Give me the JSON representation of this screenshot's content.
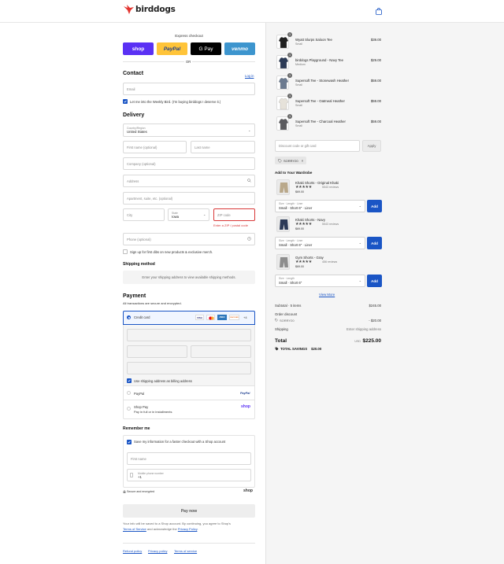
{
  "header": {
    "brand": "birddogs",
    "cart_icon": "shopping-bag-icon"
  },
  "express": {
    "title": "Express checkout",
    "shop": "shop",
    "paypal": "PayPal",
    "gpay": "G Pay",
    "venmo": "venmo",
    "or": "OR"
  },
  "contact": {
    "title": "Contact",
    "login": "Log in",
    "email_placeholder": "Email",
    "newsletter": "Let me into the Weekly Bird. (I'm buying birddogs I deserve it.)"
  },
  "delivery": {
    "title": "Delivery",
    "country_label": "Country/Region",
    "country_value": "United States",
    "first_name": "First name (optional)",
    "last_name": "Last name",
    "company": "Company (optional)",
    "address": "Address",
    "apartment": "Apartment, suite, etc. (optional)",
    "city": "City",
    "state_label": "State",
    "state_value": "Iowa",
    "zip": "ZIP code",
    "zip_error": "Enter a ZIP / postal code",
    "phone": "Phone (optional)",
    "signup": "Sign up for first dibs on new products & exclusive merch."
  },
  "shipping": {
    "title": "Shipping method",
    "note": "Enter your shipping address to view available shipping methods."
  },
  "payment": {
    "title": "Payment",
    "subtitle": "All transactions are secure and encrypted.",
    "credit_card": "Credit card",
    "card_brands": [
      "VISA",
      "MC",
      "AMEX",
      "DISCOVER",
      "+4"
    ],
    "billing_same": "Use shipping address as billing address",
    "paypal": "PayPal",
    "paypal_logo": "PayPal",
    "shop_pay": "Shop Pay",
    "shop_pay_sub": "Pay in full or in installments",
    "shop_logo": "shop"
  },
  "remember": {
    "title": "Remember me",
    "save": "Save my information for a faster checkout with a Shop account",
    "first_name": "First name",
    "mobile_label": "Mobile phone number",
    "mobile_value": "+1",
    "secure": "Secure and encrypted",
    "shop_logo": "shop"
  },
  "pay_now": "Pay now",
  "legal": {
    "text1": "Your info will be saved to a Shop account. By continuing, you agree to Shop's",
    "terms": "Terms of Service",
    "and": " and acknowledge the ",
    "privacy": "Privacy Policy",
    "end": "."
  },
  "footer": {
    "refund": "Refund policy",
    "privacy": "Privacy policy",
    "terms": "Terms of service"
  },
  "cart": {
    "items": [
      {
        "name": "Wyatt Slurps Saloon Tee",
        "variant": "Small",
        "price": "$39.00",
        "qty": "1",
        "color": "#1f1f1f"
      },
      {
        "name": "birddogs Playground - Navy Tee",
        "variant": "Medium",
        "price": "$29.00",
        "qty": "1",
        "color": "#2b3a55"
      },
      {
        "name": "Supersoft Tee - Stonewash Heather",
        "variant": "Small",
        "price": "$59.00",
        "qty": "1",
        "color": "#6b7a8f"
      },
      {
        "name": "Supersoft Tee - Oatmeal Heather",
        "variant": "Small",
        "price": "$59.00",
        "qty": "1",
        "color": "#e6e2da"
      },
      {
        "name": "Supersoft Tee - Charcoal Heather",
        "variant": "Small",
        "price": "$59.00",
        "qty": "1",
        "color": "#5a5a5e"
      }
    ],
    "discount_placeholder": "Discount code or gift card",
    "apply": "Apply",
    "code_tag": "SORRY20"
  },
  "wardrobe": {
    "title": "Add to Your Wardrobe",
    "items": [
      {
        "name": "Khaki Shorts - Original Khaki",
        "reviews": "5543 reviews",
        "price": "$69.00",
        "select_label": "Size · Length · Liner",
        "select_value": "Small · Short 6\" · Liner",
        "color": "#b9a88a"
      },
      {
        "name": "Khaki Shorts - Navy",
        "reviews": "5543 reviews",
        "price": "$69.00",
        "select_label": "Size · Length · Liner",
        "select_value": "Small · Short 6\" · Liner",
        "color": "#2c3a57"
      },
      {
        "name": "Gym Shorts - Gray",
        "reviews": "456 reviews",
        "price": "$69.00",
        "select_label": "Size · Length",
        "select_value": "Small · Short 6\"",
        "color": "#8d8d8d"
      }
    ],
    "add": "Add",
    "stars": "★★★★★",
    "view_more": "View More"
  },
  "summary": {
    "subtotal_label": "Subtotal · 5 items",
    "subtotal": "$245.00",
    "discount_label": "Order discount",
    "discount_code": "SORRY20",
    "discount": "- $20.00",
    "shipping_label": "Shipping",
    "shipping": "Enter shipping address",
    "total_label": "Total",
    "currency": "USD",
    "total": "$225.00",
    "savings_label": "TOTAL SAVINGS",
    "savings": "$20.00"
  },
  "colors": {
    "accent": "#1a55c5",
    "error": "#d83737",
    "shop": "#5a31f4",
    "paypal": "#ffc439",
    "venmo": "#3d95ce",
    "logo_red": "#e3342f"
  }
}
